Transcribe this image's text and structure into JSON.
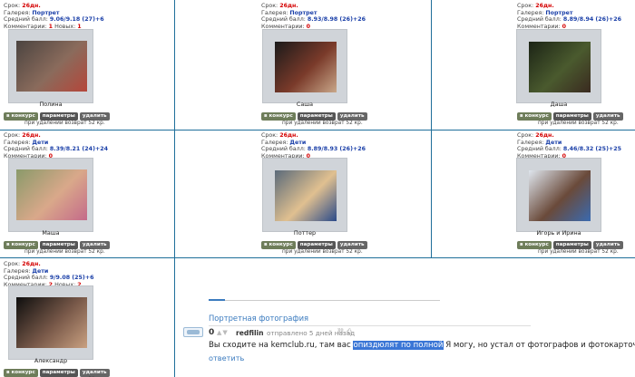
{
  "cards": [
    {
      "term_label": "Срок:",
      "term_value": "26дн.",
      "gallery_label": "Галерея:",
      "gallery_value": "Портрет",
      "score_label": "Средний балл:",
      "score_value": "9.06/9.18 (27)+6",
      "comments_label": "Комментарии:",
      "comments_value": "1",
      "new_label": "Новых:",
      "new_value": "1",
      "name": "Полина",
      "photo_colors": [
        "#4b4440",
        "#8a6b5c",
        "#b5463a"
      ]
    },
    {
      "term_label": "Срок:",
      "term_value": "26дн.",
      "gallery_label": "Галерея:",
      "gallery_value": "Портрет",
      "score_label": "Средний балл:",
      "score_value": "8.93/8.98 (26)+26",
      "comments_label": "Комментарии:",
      "comments_value": "0",
      "new_label": "",
      "new_value": "",
      "name": "Саша",
      "photo_colors": [
        "#1a1a1a",
        "#7a3a2a",
        "#c9a88a"
      ]
    },
    {
      "term_label": "Срок:",
      "term_value": "26дн.",
      "gallery_label": "Галерея:",
      "gallery_value": "Портрет",
      "score_label": "Средний балл:",
      "score_value": "8.89/8.94 (26)+26",
      "comments_label": "Комментарии:",
      "comments_value": "0",
      "new_label": "",
      "new_value": "",
      "name": "Даша",
      "photo_colors": [
        "#1c2416",
        "#4a5a2e",
        "#3a2a20"
      ]
    },
    {
      "term_label": "Срок:",
      "term_value": "26дн.",
      "gallery_label": "Галерея:",
      "gallery_value": "Дети",
      "score_label": "Средний балл:",
      "score_value": "8.39/8.21 (24)+24",
      "comments_label": "Комментарии:",
      "comments_value": "0",
      "new_label": "",
      "new_value": "",
      "name": "Маша",
      "photo_colors": [
        "#8a9a6a",
        "#d9a88a",
        "#c46a8a"
      ]
    },
    {
      "term_label": "Срок:",
      "term_value": "26дн.",
      "gallery_label": "Галерея:",
      "gallery_value": "Дети",
      "score_label": "Средний балл:",
      "score_value": "8.89/8.93 (26)+26",
      "comments_label": "Комментарии:",
      "comments_value": "0",
      "new_label": "",
      "new_value": "",
      "name": "Поттер",
      "photo_colors": [
        "#5a6a7a",
        "#e0c090",
        "#2a4a8a"
      ]
    },
    {
      "term_label": "Срок:",
      "term_value": "26дн.",
      "gallery_label": "Галерея:",
      "gallery_value": "Дети",
      "score_label": "Средний балл:",
      "score_value": "8.46/8.32 (25)+25",
      "comments_label": "Комментарии:",
      "comments_value": "0",
      "new_label": "",
      "new_value": "",
      "name": "Игорь и Ирина",
      "photo_colors": [
        "#dfe6ee",
        "#6a4a3a",
        "#3a6ab0"
      ]
    },
    {
      "term_label": "Срок:",
      "term_value": "26дн.",
      "gallery_label": "Галерея:",
      "gallery_value": "Дети",
      "score_label": "Средний балл:",
      "score_value": "9/9.08 (25)+6",
      "comments_label": "Комментарии:",
      "comments_value": "2",
      "new_label": "Новых:",
      "new_value": "2",
      "name": "Александр",
      "photo_colors": [
        "#0e0e0e",
        "#7a5a4a",
        "#c9a080"
      ]
    }
  ],
  "buttons": {
    "contest": "в конкурс",
    "params": "параметры",
    "delete": "удалить"
  },
  "refund_text": "при удалении возврат 52 кр.",
  "comment": {
    "category": "Портретная фотография",
    "votes": "0",
    "vote_arrows": "▲▼",
    "author": "redfilin",
    "sent": "отправлено 5 дней назад",
    "actions": "⛓ ⎙",
    "text_before": "Вы сходите на kemclub.ru, там вас ",
    "text_highlight": "опиздюлят по полной",
    "text_after": " Я могу, но устал от фотографов и фотокарточек.",
    "reply": "ответить"
  },
  "colors": {
    "grid_line": "#1f6f9a",
    "red_value": "#d40000",
    "blue_value": "#1a3fa8",
    "link": "#3b7bbf",
    "highlight": "#3a76d6"
  }
}
